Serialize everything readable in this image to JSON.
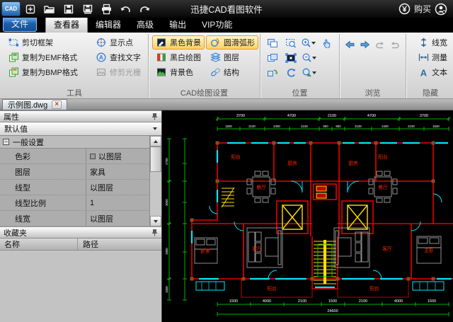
{
  "titlebar": {
    "logo": "CAD",
    "title": "迅捷CAD看图软件",
    "buy": "购买"
  },
  "tabs": {
    "items": [
      "文件",
      "查看器",
      "编辑器",
      "高级",
      "输出",
      "VIP功能"
    ]
  },
  "ribbon": {
    "groups": {
      "tools": {
        "label": "工具",
        "buttons": [
          "剪切框架",
          "复制为EMF格式",
          "复制为BMP格式",
          "显示点",
          "查找文字",
          "修剪光栅"
        ]
      },
      "cad_settings": {
        "label": "CAD绘图设置",
        "buttons": [
          "黑色背景",
          "黑白绘图",
          "背景色",
          "圆滑弧形",
          "图层",
          "结构"
        ]
      },
      "position": {
        "label": "位置"
      },
      "browse": {
        "label": "浏览"
      },
      "hide": {
        "label": "隐藏",
        "buttons": [
          "线宽",
          "测量",
          "文本"
        ]
      }
    }
  },
  "doctab": {
    "name": "示例图.dwg"
  },
  "properties": {
    "title": "属性",
    "preset": "默认值",
    "group_label": "一般设置",
    "rows": [
      {
        "name": "色彩",
        "value": "以图层"
      },
      {
        "name": "图层",
        "value": "家具"
      },
      {
        "name": "线型",
        "value": "以图层"
      },
      {
        "name": "线型比例",
        "value": "1"
      },
      {
        "name": "线宽",
        "value": "以图层"
      }
    ]
  },
  "favorites": {
    "title": "收藏夹",
    "columns": [
      "名称",
      "路径"
    ]
  },
  "canvas": {
    "room_labels": {
      "balcony": "阳台",
      "kitchen": "厨房",
      "dining": "餐厅",
      "living": "客厅",
      "bedroom": "卧室",
      "master_bedroom": "主卧"
    },
    "dims": {
      "top_row1": [
        "3700",
        "4700",
        "2100",
        "4700",
        "3700"
      ],
      "top_row2": [
        "1500",
        "2100",
        "2400",
        "2100",
        "900",
        "900",
        "2100",
        "2400",
        "2100",
        "1500"
      ],
      "bottom_row1": [
        "1500",
        "4000",
        "2100",
        "1500",
        "2100",
        "4000",
        "1500"
      ],
      "bottom_total": "24600",
      "left_col": [
        "2700",
        "3000",
        "3900",
        "1500"
      ]
    },
    "colors": {
      "wall": "#e80000",
      "window": "#00e5ff",
      "dimension": "#00b400",
      "stair": "#ffe000",
      "label": "#ff2400",
      "furniture": "#a0a0a0"
    }
  }
}
